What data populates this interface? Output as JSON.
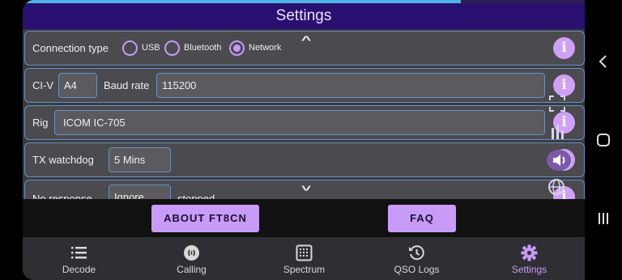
{
  "header": {
    "title": "Settings",
    "progress_fraction": 0.78
  },
  "rows": {
    "connection": {
      "label": "Connection type",
      "options": [
        {
          "label": "USB",
          "checked": false
        },
        {
          "label": "Bluetooth",
          "checked": false
        },
        {
          "label": "Network",
          "checked": true
        }
      ]
    },
    "civ": {
      "label": "CI-V",
      "value": "A4",
      "baud_label": "Baud rate",
      "baud_value": "115200"
    },
    "rig": {
      "label": "Rig",
      "value": "ICOM IC-705"
    },
    "tx_watchdog": {
      "label": "TX watchdog",
      "value": "5 Mins"
    },
    "no_response": {
      "label": "No response",
      "value": "Ignore",
      "suffix": "stopped"
    }
  },
  "actions": {
    "about_label": "ABOUT FT8CN",
    "faq_label": "FAQ"
  },
  "nav": {
    "items": [
      {
        "label": "Decode",
        "icon": "list-icon",
        "active": false
      },
      {
        "label": "Calling",
        "icon": "calling-icon",
        "active": false
      },
      {
        "label": "Spectrum",
        "icon": "spectrum-icon",
        "active": false
      },
      {
        "label": "QSO Logs",
        "icon": "history-icon",
        "active": false
      },
      {
        "label": "Settings",
        "icon": "gear-icon",
        "active": true
      }
    ]
  },
  "colors": {
    "accent": "#c99bf8",
    "header": "#2a1070",
    "field_border": "#6a90c6"
  },
  "info_glyph": "i"
}
